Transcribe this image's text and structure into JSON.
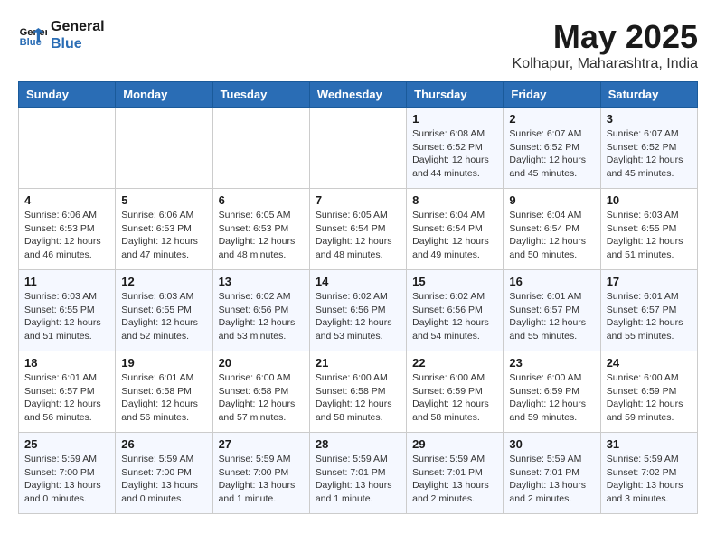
{
  "logo": {
    "line1": "General",
    "line2": "Blue"
  },
  "title": "May 2025",
  "subtitle": "Kolhapur, Maharashtra, India",
  "days_of_week": [
    "Sunday",
    "Monday",
    "Tuesday",
    "Wednesday",
    "Thursday",
    "Friday",
    "Saturday"
  ],
  "weeks": [
    [
      {
        "day": "",
        "info": ""
      },
      {
        "day": "",
        "info": ""
      },
      {
        "day": "",
        "info": ""
      },
      {
        "day": "",
        "info": ""
      },
      {
        "day": "1",
        "info": "Sunrise: 6:08 AM\nSunset: 6:52 PM\nDaylight: 12 hours\nand 44 minutes."
      },
      {
        "day": "2",
        "info": "Sunrise: 6:07 AM\nSunset: 6:52 PM\nDaylight: 12 hours\nand 45 minutes."
      },
      {
        "day": "3",
        "info": "Sunrise: 6:07 AM\nSunset: 6:52 PM\nDaylight: 12 hours\nand 45 minutes."
      }
    ],
    [
      {
        "day": "4",
        "info": "Sunrise: 6:06 AM\nSunset: 6:53 PM\nDaylight: 12 hours\nand 46 minutes."
      },
      {
        "day": "5",
        "info": "Sunrise: 6:06 AM\nSunset: 6:53 PM\nDaylight: 12 hours\nand 47 minutes."
      },
      {
        "day": "6",
        "info": "Sunrise: 6:05 AM\nSunset: 6:53 PM\nDaylight: 12 hours\nand 48 minutes."
      },
      {
        "day": "7",
        "info": "Sunrise: 6:05 AM\nSunset: 6:54 PM\nDaylight: 12 hours\nand 48 minutes."
      },
      {
        "day": "8",
        "info": "Sunrise: 6:04 AM\nSunset: 6:54 PM\nDaylight: 12 hours\nand 49 minutes."
      },
      {
        "day": "9",
        "info": "Sunrise: 6:04 AM\nSunset: 6:54 PM\nDaylight: 12 hours\nand 50 minutes."
      },
      {
        "day": "10",
        "info": "Sunrise: 6:03 AM\nSunset: 6:55 PM\nDaylight: 12 hours\nand 51 minutes."
      }
    ],
    [
      {
        "day": "11",
        "info": "Sunrise: 6:03 AM\nSunset: 6:55 PM\nDaylight: 12 hours\nand 51 minutes."
      },
      {
        "day": "12",
        "info": "Sunrise: 6:03 AM\nSunset: 6:55 PM\nDaylight: 12 hours\nand 52 minutes."
      },
      {
        "day": "13",
        "info": "Sunrise: 6:02 AM\nSunset: 6:56 PM\nDaylight: 12 hours\nand 53 minutes."
      },
      {
        "day": "14",
        "info": "Sunrise: 6:02 AM\nSunset: 6:56 PM\nDaylight: 12 hours\nand 53 minutes."
      },
      {
        "day": "15",
        "info": "Sunrise: 6:02 AM\nSunset: 6:56 PM\nDaylight: 12 hours\nand 54 minutes."
      },
      {
        "day": "16",
        "info": "Sunrise: 6:01 AM\nSunset: 6:57 PM\nDaylight: 12 hours\nand 55 minutes."
      },
      {
        "day": "17",
        "info": "Sunrise: 6:01 AM\nSunset: 6:57 PM\nDaylight: 12 hours\nand 55 minutes."
      }
    ],
    [
      {
        "day": "18",
        "info": "Sunrise: 6:01 AM\nSunset: 6:57 PM\nDaylight: 12 hours\nand 56 minutes."
      },
      {
        "day": "19",
        "info": "Sunrise: 6:01 AM\nSunset: 6:58 PM\nDaylight: 12 hours\nand 56 minutes."
      },
      {
        "day": "20",
        "info": "Sunrise: 6:00 AM\nSunset: 6:58 PM\nDaylight: 12 hours\nand 57 minutes."
      },
      {
        "day": "21",
        "info": "Sunrise: 6:00 AM\nSunset: 6:58 PM\nDaylight: 12 hours\nand 58 minutes."
      },
      {
        "day": "22",
        "info": "Sunrise: 6:00 AM\nSunset: 6:59 PM\nDaylight: 12 hours\nand 58 minutes."
      },
      {
        "day": "23",
        "info": "Sunrise: 6:00 AM\nSunset: 6:59 PM\nDaylight: 12 hours\nand 59 minutes."
      },
      {
        "day": "24",
        "info": "Sunrise: 6:00 AM\nSunset: 6:59 PM\nDaylight: 12 hours\nand 59 minutes."
      }
    ],
    [
      {
        "day": "25",
        "info": "Sunrise: 5:59 AM\nSunset: 7:00 PM\nDaylight: 13 hours\nand 0 minutes."
      },
      {
        "day": "26",
        "info": "Sunrise: 5:59 AM\nSunset: 7:00 PM\nDaylight: 13 hours\nand 0 minutes."
      },
      {
        "day": "27",
        "info": "Sunrise: 5:59 AM\nSunset: 7:00 PM\nDaylight: 13 hours\nand 1 minute."
      },
      {
        "day": "28",
        "info": "Sunrise: 5:59 AM\nSunset: 7:01 PM\nDaylight: 13 hours\nand 1 minute."
      },
      {
        "day": "29",
        "info": "Sunrise: 5:59 AM\nSunset: 7:01 PM\nDaylight: 13 hours\nand 2 minutes."
      },
      {
        "day": "30",
        "info": "Sunrise: 5:59 AM\nSunset: 7:01 PM\nDaylight: 13 hours\nand 2 minutes."
      },
      {
        "day": "31",
        "info": "Sunrise: 5:59 AM\nSunset: 7:02 PM\nDaylight: 13 hours\nand 3 minutes."
      }
    ]
  ]
}
